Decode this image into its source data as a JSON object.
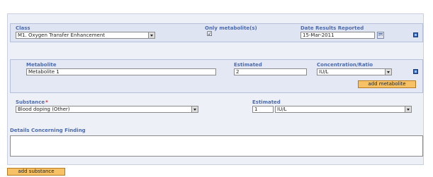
{
  "class_field": {
    "label": "Class",
    "value": "M1. Oxygen Transfer Enhancement"
  },
  "only_metabolite": {
    "label": "Only metabolite(s)",
    "checked": true,
    "mark": "☑"
  },
  "date_reported": {
    "label": "Date Results Reported",
    "value": "15-Mar-2011",
    "icon": "calendar-icon"
  },
  "metabolite": {
    "name_label": "Metabolite",
    "name_value": "Metabolite 1",
    "estimated_label": "Estimated",
    "estimated_value": "2",
    "concentration_label": "Concentration/Ratio",
    "concentration_value": "IU/L",
    "add_label": "add metabolite"
  },
  "substance": {
    "label": "Substance",
    "required_mark": "*",
    "value": "Blood doping (Other)",
    "estimated_label": "Estimated",
    "estimated_value": "1",
    "unit_value": "IU/L"
  },
  "details": {
    "label": "Details Concerning Finding",
    "value": ""
  },
  "add_substance_label": "add substance",
  "colors": {
    "label": "#4b6bb0",
    "button": "#f6c265",
    "panel": "#eef0f7",
    "band": "#dfe4f2"
  }
}
